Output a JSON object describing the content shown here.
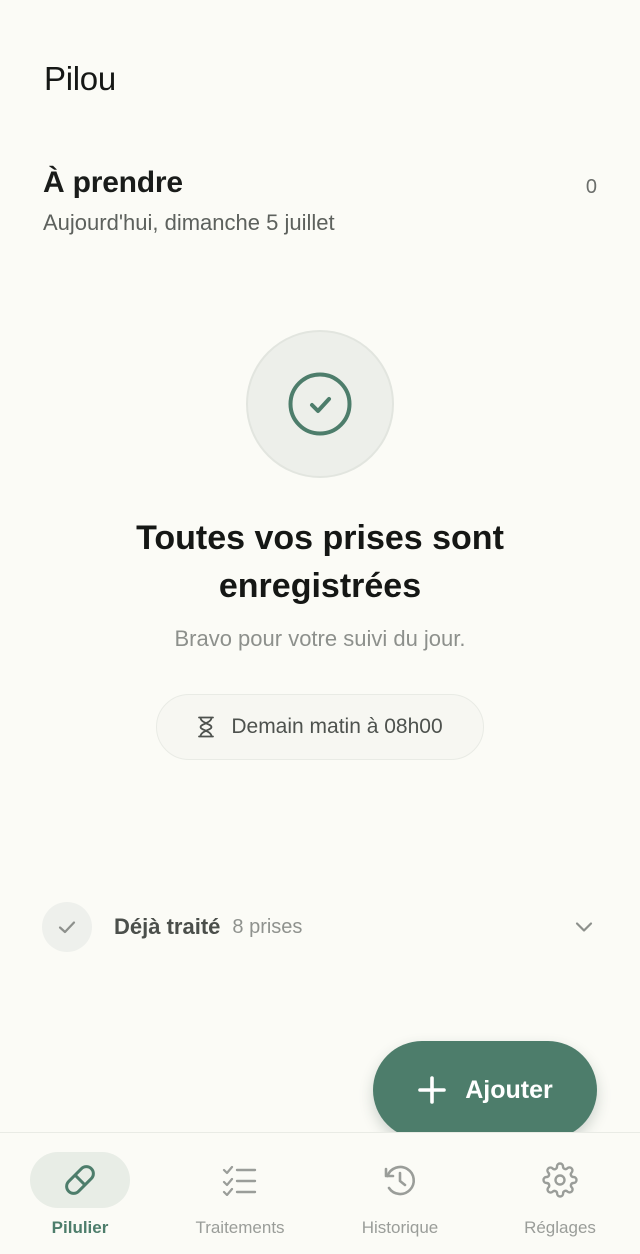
{
  "app": {
    "title": "Pilou"
  },
  "section": {
    "title": "À prendre",
    "count": "0",
    "date": "Aujourd'hui, dimanche 5 juillet"
  },
  "empty_state": {
    "icon": "check-circle-icon",
    "title_line1": "Toutes vos prises sont",
    "title_line2": "enregistrées",
    "subtitle": "Bravo pour votre suivi du jour.",
    "next_dose": {
      "icon": "hourglass-icon",
      "label": "Demain matin à 08h00"
    }
  },
  "already_treated": {
    "icon": "check-icon",
    "label": "Déjà traité",
    "count": "8 prises",
    "expand_icon": "chevron-down-icon"
  },
  "fab": {
    "icon": "plus-icon",
    "label": "Ajouter"
  },
  "bottom_nav": {
    "active": "Pilulier",
    "items": [
      {
        "label": "Pilulier",
        "icon": "pill-icon"
      },
      {
        "label": "Traitements",
        "icon": "checklist-icon"
      },
      {
        "label": "Historique",
        "icon": "history-icon"
      },
      {
        "label": "Réglages",
        "icon": "gear-icon"
      }
    ]
  },
  "colors": {
    "accent": "#4d7d6b",
    "background": "#fbfbf6",
    "text": "#1a1c1a",
    "muted": "#8d908c"
  }
}
